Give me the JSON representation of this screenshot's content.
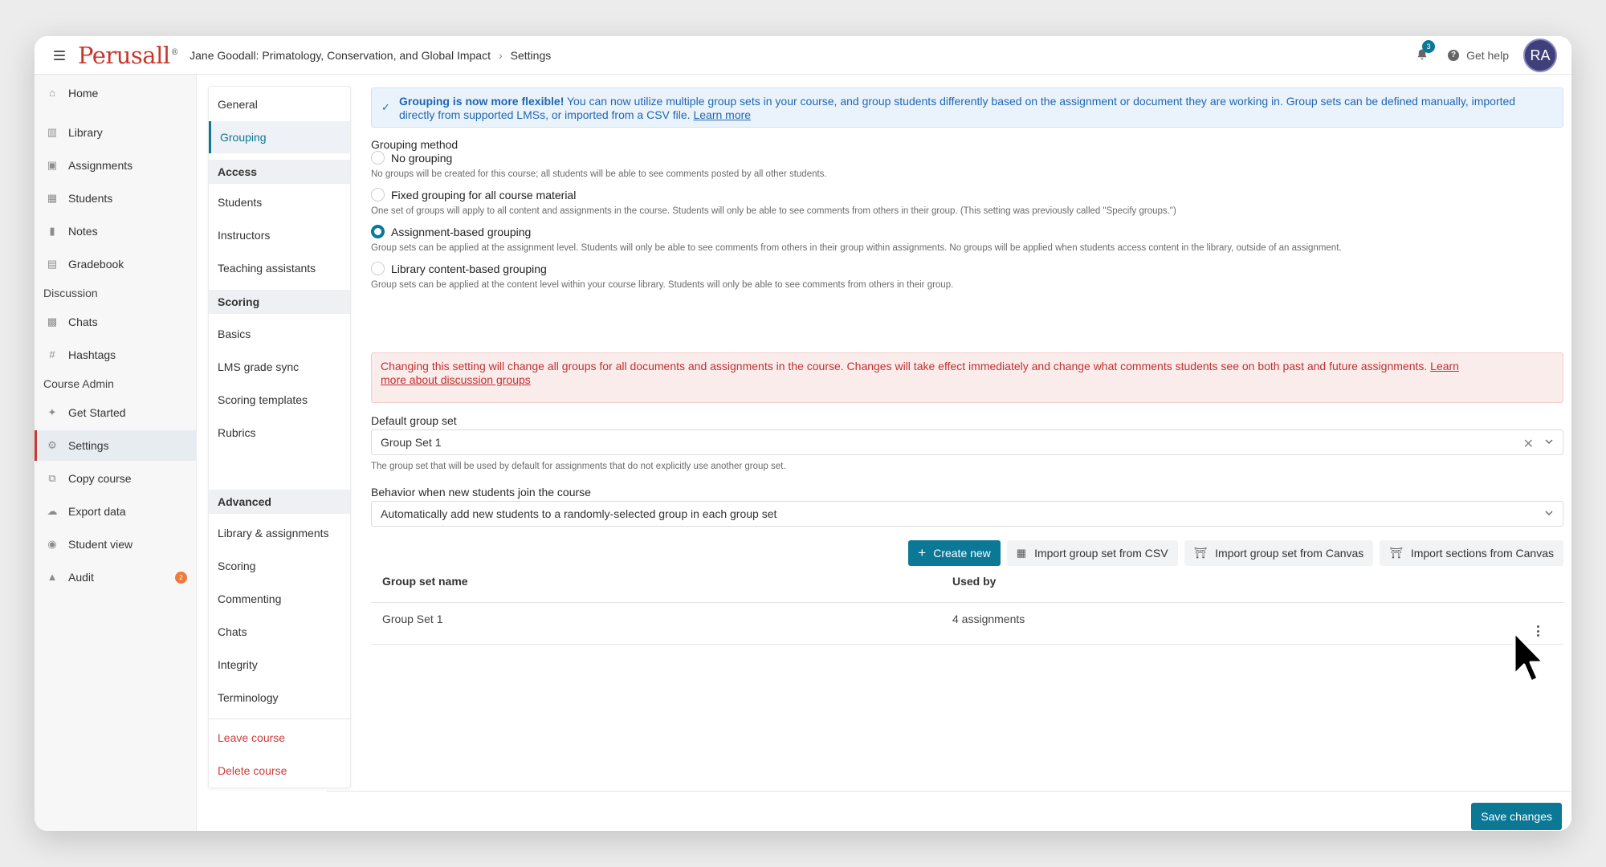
{
  "header": {
    "logo": "Perusall",
    "logo_mark": "®",
    "course": "Jane Goodall: Primatology, Conservation, and Global Impact",
    "current": "Settings",
    "notification_count": "3",
    "help": "Get help",
    "avatar": "RA"
  },
  "leftnav": {
    "items": [
      {
        "label": "Home",
        "icon": "home-icon"
      },
      {
        "label": "Library",
        "icon": "library-icon"
      },
      {
        "label": "Assignments",
        "icon": "calendar-icon"
      },
      {
        "label": "Students",
        "icon": "students-icon"
      },
      {
        "label": "Notes",
        "icon": "notes-icon"
      },
      {
        "label": "Gradebook",
        "icon": "gradebook-icon"
      }
    ],
    "discussion_title": "Discussion",
    "discussion": [
      {
        "label": "Chats",
        "icon": "chat-icon"
      },
      {
        "label": "Hashtags",
        "icon": "hashtag-icon"
      }
    ],
    "admin_title": "Course Admin",
    "admin": [
      {
        "label": "Get Started",
        "icon": "wand-icon"
      },
      {
        "label": "Settings",
        "icon": "gear-icon"
      },
      {
        "label": "Copy course",
        "icon": "copy-icon"
      },
      {
        "label": "Export data",
        "icon": "cloud-icon"
      },
      {
        "label": "Student view",
        "icon": "eye-icon"
      },
      {
        "label": "Audit",
        "icon": "warning-icon"
      }
    ],
    "audit_badge": "2"
  },
  "submenu": {
    "general": "General",
    "grouping": "Grouping",
    "access_title": "Access",
    "access": [
      "Students",
      "Instructors",
      "Teaching assistants"
    ],
    "scoring_title": "Scoring",
    "scoring": [
      "Basics",
      "LMS grade sync",
      "Scoring templates",
      "Rubrics"
    ],
    "advanced_title": "Advanced",
    "advanced": [
      "Library & assignments",
      "Scoring",
      "Commenting",
      "Chats",
      "Integrity",
      "Terminology"
    ],
    "leave": "Leave course",
    "delete": "Delete course"
  },
  "main": {
    "banner_bold": "Grouping is now more flexible!",
    "banner_text": " You can now utilize multiple group sets in your course, and group students differently based on the assignment or document they are working in. Group sets can be defined manually, imported directly from supported LMSs, or imported from a CSV file. ",
    "banner_link": "Learn more",
    "method_label": "Grouping method",
    "options": [
      {
        "label": "No grouping",
        "desc": "No groups will be created for this course; all students will be able to see comments posted by all other students."
      },
      {
        "label": "Fixed grouping for all course material",
        "desc": "One set of groups will apply to all content and assignments in the course. Students will only be able to see comments from others in their group. (This setting was previously called \"Specify groups.\")"
      },
      {
        "label": "Assignment-based grouping",
        "desc": "Group sets can be applied at the assignment level. Students will only be able to see comments from others in their group within assignments. No groups will be applied when students access content in the library, outside of an assignment."
      },
      {
        "label": "Library content-based grouping",
        "desc": "Group sets can be applied at the content level within your course library. Students will only be able to see comments from others in their group."
      }
    ],
    "selected_option": "Assignment-based grouping",
    "warning_text": "Changing this setting will change all groups for all documents and assignments in the course. Changes will take effect immediately and change what comments students see on both past and future assignments. ",
    "warning_link_1": "Learn",
    "warning_link_2": "more about discussion groups",
    "default_label": "Default group set",
    "default_value": "Group Set 1",
    "default_help": "The group set that will be used by default for assignments that do not explicitly use another group set.",
    "behavior_label": "Behavior when new students join the course",
    "behavior_value": "Automatically add new students to a randomly-selected group in each group set",
    "buttons": {
      "create": "Create new",
      "import_csv": "Import group set from CSV",
      "import_canvas": "Import group set from Canvas",
      "import_sections": "Import sections from Canvas"
    },
    "table": {
      "headers": [
        "Group set name",
        "Used by"
      ],
      "rows": [
        [
          "Group Set 1",
          "4 assignments"
        ]
      ]
    },
    "save": "Save changes"
  },
  "colors": {
    "brand": "#c9362c",
    "accent": "#0b7896",
    "info": "#1f66b3",
    "danger": "#c13030"
  }
}
